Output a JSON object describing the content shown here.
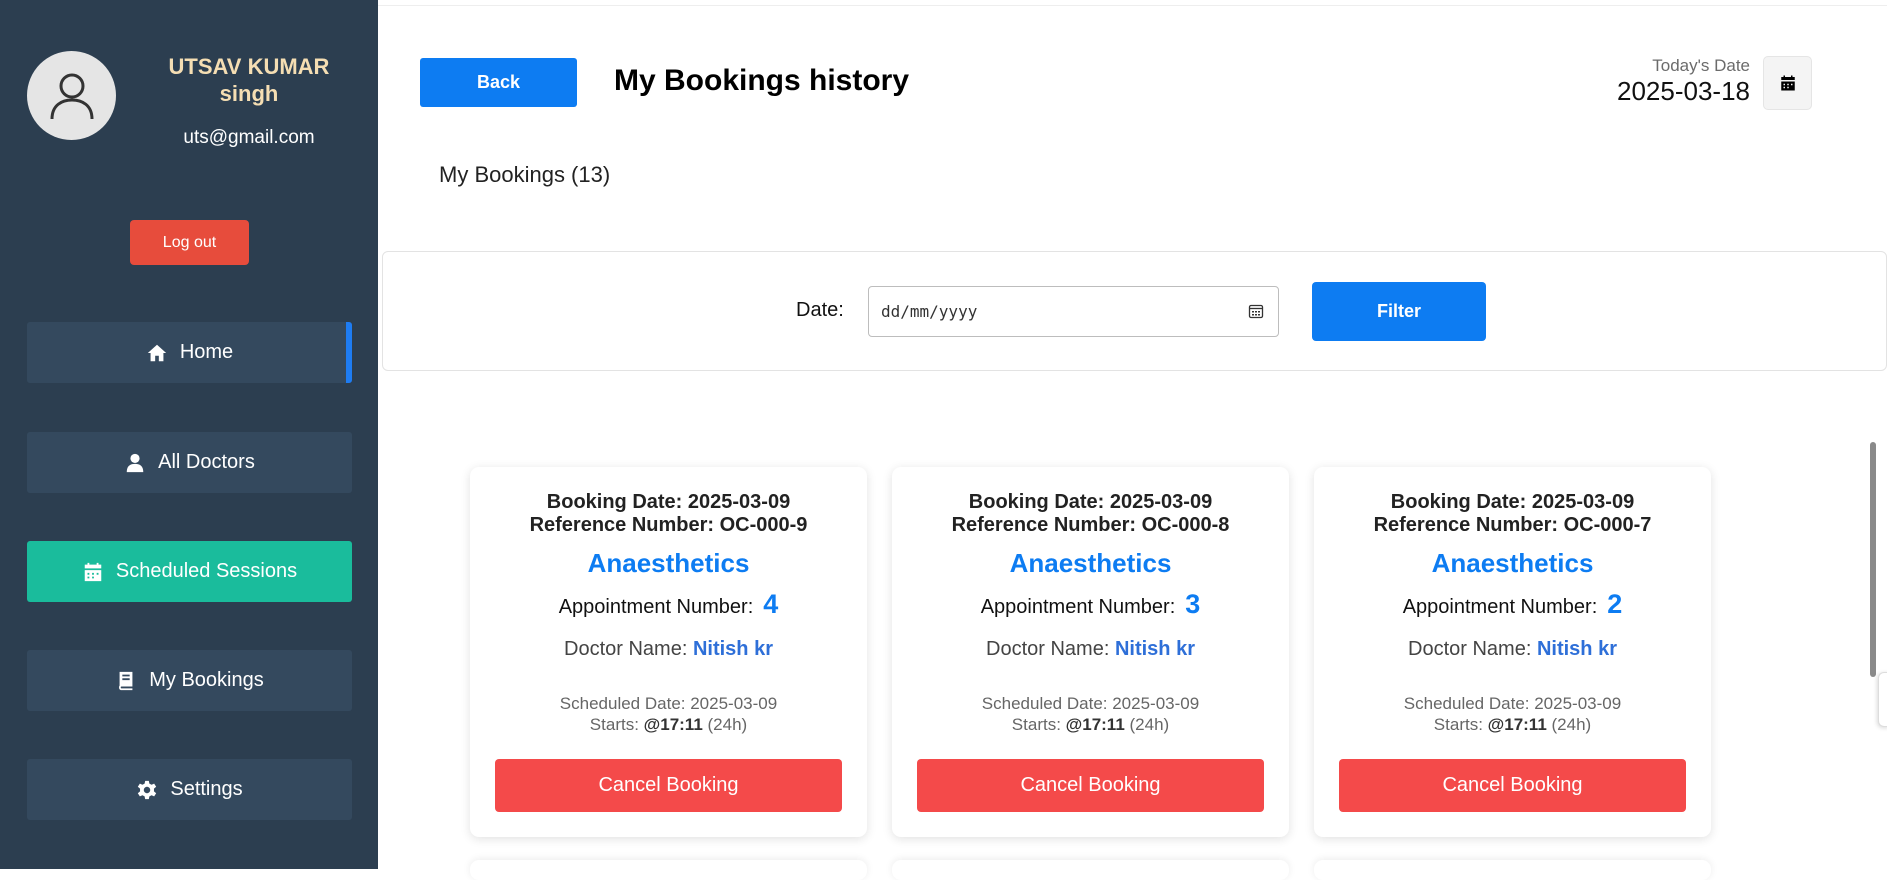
{
  "user": {
    "name": "UTSAV KUMAR singh",
    "email": "uts@gmail.com",
    "logout_label": "Log out"
  },
  "nav": {
    "items": [
      {
        "label": "Home",
        "icon": "home-icon"
      },
      {
        "label": "All Doctors",
        "icon": "doctor-icon"
      },
      {
        "label": "Scheduled Sessions",
        "icon": "calendar-icon"
      },
      {
        "label": "My Bookings",
        "icon": "book-icon"
      },
      {
        "label": "Settings",
        "icon": "gear-icon"
      }
    ],
    "active": "Scheduled Sessions"
  },
  "header": {
    "back_label": "Back",
    "title": "My Bookings history",
    "today_label": "Today's Date",
    "today_value": "2025-03-18"
  },
  "bookings_count_label": "My Bookings (13)",
  "filter": {
    "date_label": "Date:",
    "date_placeholder": "dd/mm/yyyy",
    "filter_label": "Filter"
  },
  "cards": [
    {
      "booking_date": "Booking Date: 2025-03-09",
      "reference": "Reference Number: OC-000-9",
      "specialty": "Anaesthetics",
      "appointment_label": "Appointment Number:",
      "appointment_number": "4",
      "doctor_label": "Doctor Name:",
      "doctor_name": "Nitish kr",
      "scheduled": "Scheduled Date: 2025-03-09",
      "starts_prefix": "Starts:",
      "starts_time": "@17:11",
      "starts_suffix": "(24h)",
      "cancel_label": "Cancel Booking"
    },
    {
      "booking_date": "Booking Date: 2025-03-09",
      "reference": "Reference Number: OC-000-8",
      "specialty": "Anaesthetics",
      "appointment_label": "Appointment Number:",
      "appointment_number": "3",
      "doctor_label": "Doctor Name:",
      "doctor_name": "Nitish kr",
      "scheduled": "Scheduled Date: 2025-03-09",
      "starts_prefix": "Starts:",
      "starts_time": "@17:11",
      "starts_suffix": "(24h)",
      "cancel_label": "Cancel Booking"
    },
    {
      "booking_date": "Booking Date: 2025-03-09",
      "reference": "Reference Number: OC-000-7",
      "specialty": "Anaesthetics",
      "appointment_label": "Appointment Number:",
      "appointment_number": "2",
      "doctor_label": "Doctor Name:",
      "doctor_name": "Nitish kr",
      "scheduled": "Scheduled Date: 2025-03-09",
      "starts_prefix": "Starts:",
      "starts_time": "@17:11",
      "starts_suffix": "(24h)",
      "cancel_label": "Cancel Booking"
    }
  ],
  "colors": {
    "sidebar": "#2c3e50",
    "nav_item": "#34495e",
    "active_nav": "#1abc9c",
    "primary": "#0d7cf2",
    "cancel": "#f44a4a",
    "logout": "#e74c3c",
    "user_name": "#f5deb3"
  }
}
